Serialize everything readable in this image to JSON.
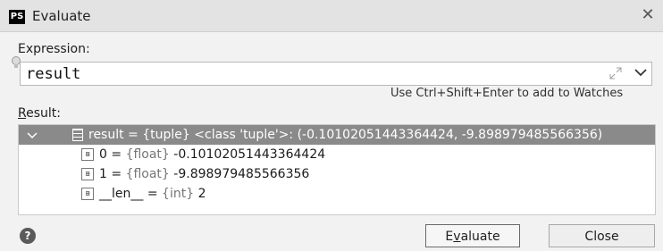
{
  "window": {
    "title": "Evaluate",
    "app_icon_text": "PS",
    "close_glyph": "✕"
  },
  "expression": {
    "label": "Expression:",
    "value": "result",
    "hint": "Use Ctrl+Shift+Enter to add to Watches"
  },
  "result": {
    "label_prefix": "R",
    "label_rest": "esult:",
    "rows": [
      {
        "name": "result",
        "type": "{tuple}",
        "value": "<class 'tuple'>: (-0.10102051443364424, -9.898979485566356)",
        "expanded": true,
        "selected": true,
        "icon": "structure-icon"
      },
      {
        "name": "0",
        "type": "{float}",
        "value": "-0.10102051443364424",
        "icon": "primitive-icon"
      },
      {
        "name": "1",
        "type": "{float}",
        "value": "-9.898979485566356",
        "icon": "primitive-icon"
      },
      {
        "name": "__len__",
        "type": "{int}",
        "value": "2",
        "icon": "primitive-icon"
      }
    ],
    "icon_glyph": "01\n10"
  },
  "buttons": {
    "evaluate_prefix": "E",
    "evaluate_mnemonic": "v",
    "evaluate_rest": "aluate",
    "close": "Close",
    "help": "?"
  },
  "colors": {
    "selection": "#8a8a8a",
    "title_bar": "#e3e3e3",
    "dialog_bg": "#f2f2f2"
  }
}
